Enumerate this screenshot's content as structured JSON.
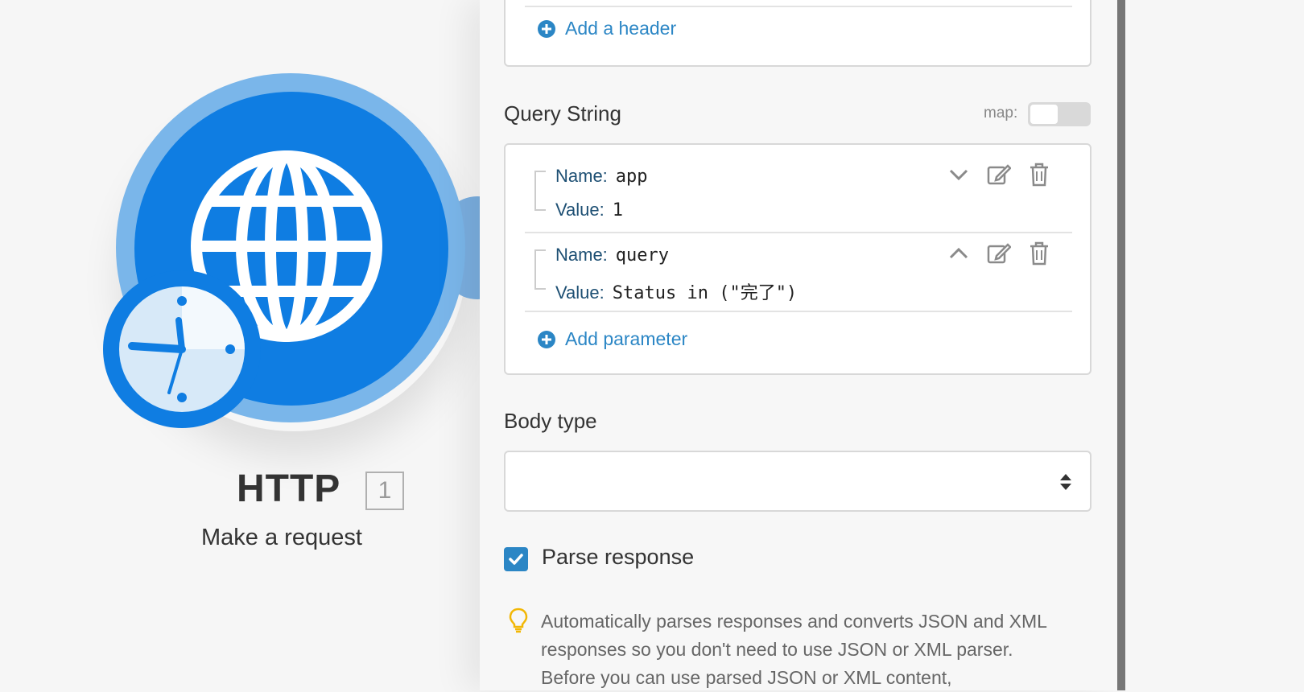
{
  "module": {
    "title": "HTTP",
    "badge": "1",
    "subtitle": "Make a request",
    "icon": "globe-icon",
    "clock_icon": "clock-icon"
  },
  "headers": {
    "add_label": "Add a header"
  },
  "query": {
    "section_label": "Query String",
    "map_label": "map:",
    "params": [
      {
        "name_key": "Name:",
        "name": "app",
        "value_key": "Value:",
        "value": "1",
        "expanded": false
      },
      {
        "name_key": "Name:",
        "name": "query",
        "value_key": "Value:",
        "value": "Status in (\"完了\")",
        "expanded": true
      }
    ],
    "add_label": "Add parameter"
  },
  "body": {
    "section_label": "Body type",
    "selected": ""
  },
  "parse": {
    "label": "Parse response",
    "checked": true,
    "hint": "Automatically parses responses and converts JSON and XML responses so you don't need to use JSON or XML parser. Before you can use parsed JSON or XML content,"
  },
  "colors": {
    "accent": "#2b86c5",
    "module_blue": "#0f7de2",
    "module_ring": "#7ab6ea"
  }
}
